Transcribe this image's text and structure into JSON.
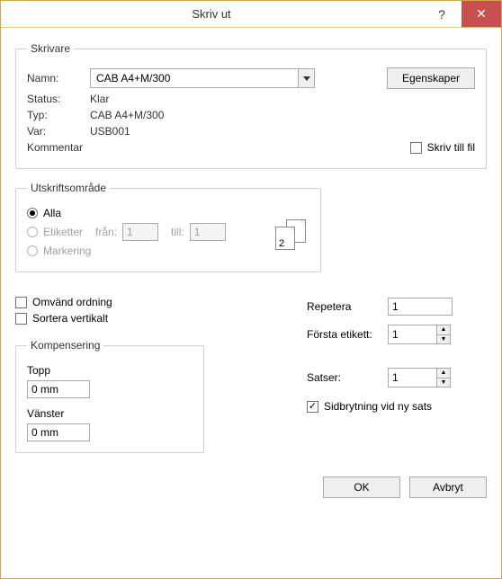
{
  "title": "Skriv ut",
  "help_glyph": "?",
  "close_glyph": "✕",
  "printer": {
    "legend": "Skrivare",
    "name_label": "Namn:",
    "name_value": "CAB A4+M/300",
    "properties_button": "Egenskaper",
    "status_label": "Status:",
    "status_value": "Klar",
    "type_label": "Typ:",
    "type_value": "CAB A4+M/300",
    "where_label": "Var:",
    "where_value": "USB001",
    "comment_label": "Kommentar",
    "print_to_file_label": "Skriv till fil"
  },
  "range": {
    "legend": "Utskriftsområde",
    "all_label": "Alla",
    "labels_label": "Etiketter",
    "from_label": "från:",
    "from_value": "1",
    "to_label": "till:",
    "to_value": "1",
    "selection_label": "Markering",
    "page_num_back": "2",
    "page_num_front": "2"
  },
  "options": {
    "reverse_order_label": "Omvänd ordning",
    "sort_vertical_label": "Sortera vertikalt"
  },
  "compensation": {
    "legend": "Kompensering",
    "top_label": "Topp",
    "top_value": "0 mm",
    "left_label": "Vänster",
    "left_value": "0 mm"
  },
  "repeat": {
    "repeat_label": "Repetera",
    "repeat_value": "1",
    "first_label_label": "Första etikett:",
    "first_label_value": "1",
    "batches_label": "Satser:",
    "batches_value": "1",
    "pagebreak_label": "Sidbrytning vid ny sats"
  },
  "footer": {
    "ok": "OK",
    "cancel": "Avbryt"
  }
}
